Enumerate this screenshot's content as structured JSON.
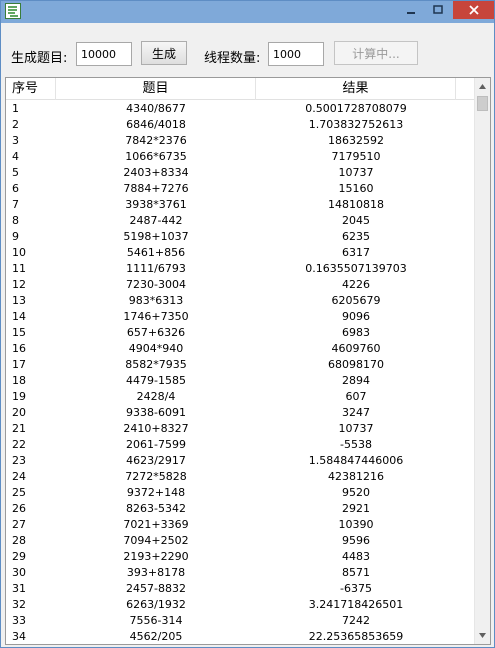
{
  "toolbar": {
    "generate_count_label": "生成题目:",
    "generate_count_value": "10000",
    "generate_button": "生成",
    "thread_count_label": "线程数量:",
    "thread_count_value": "1000",
    "compute_button": "计算中..."
  },
  "list": {
    "headers": [
      "序号",
      "题目",
      "结果"
    ],
    "rows": [
      [
        "1",
        "4340/8677",
        "0.5001728708079"
      ],
      [
        "2",
        "6846/4018",
        "1.703832752613"
      ],
      [
        "3",
        "7842*2376",
        "18632592"
      ],
      [
        "4",
        "1066*6735",
        "7179510"
      ],
      [
        "5",
        "2403+8334",
        "10737"
      ],
      [
        "6",
        "7884+7276",
        "15160"
      ],
      [
        "7",
        "3938*3761",
        "14810818"
      ],
      [
        "8",
        "2487-442",
        "2045"
      ],
      [
        "9",
        "5198+1037",
        "6235"
      ],
      [
        "10",
        "5461+856",
        "6317"
      ],
      [
        "11",
        "1111/6793",
        "0.1635507139703"
      ],
      [
        "12",
        "7230-3004",
        "4226"
      ],
      [
        "13",
        "983*6313",
        "6205679"
      ],
      [
        "14",
        "1746+7350",
        "9096"
      ],
      [
        "15",
        "657+6326",
        "6983"
      ],
      [
        "16",
        "4904*940",
        "4609760"
      ],
      [
        "17",
        "8582*7935",
        "68098170"
      ],
      [
        "18",
        "4479-1585",
        "2894"
      ],
      [
        "19",
        "2428/4",
        "607"
      ],
      [
        "20",
        "9338-6091",
        "3247"
      ],
      [
        "21",
        "2410+8327",
        "10737"
      ],
      [
        "22",
        "2061-7599",
        "-5538"
      ],
      [
        "23",
        "4623/2917",
        "1.584847446006"
      ],
      [
        "24",
        "7272*5828",
        "42381216"
      ],
      [
        "25",
        "9372+148",
        "9520"
      ],
      [
        "26",
        "8263-5342",
        "2921"
      ],
      [
        "27",
        "7021+3369",
        "10390"
      ],
      [
        "28",
        "7094+2502",
        "9596"
      ],
      [
        "29",
        "2193+2290",
        "4483"
      ],
      [
        "30",
        "393+8178",
        "8571"
      ],
      [
        "31",
        "2457-8832",
        "-6375"
      ],
      [
        "32",
        "6263/1932",
        "3.241718426501"
      ],
      [
        "33",
        "7556-314",
        "7242"
      ],
      [
        "34",
        "4562/205",
        "22.25365853659"
      ]
    ]
  },
  "icons": {
    "app": "app-icon",
    "minimize": "minimize-icon",
    "maximize": "maximize-icon",
    "close": "close-icon"
  },
  "colors": {
    "titlebar": "#7fa9d9",
    "close_button": "#c7453b",
    "window_background": "#f0f0f0"
  }
}
